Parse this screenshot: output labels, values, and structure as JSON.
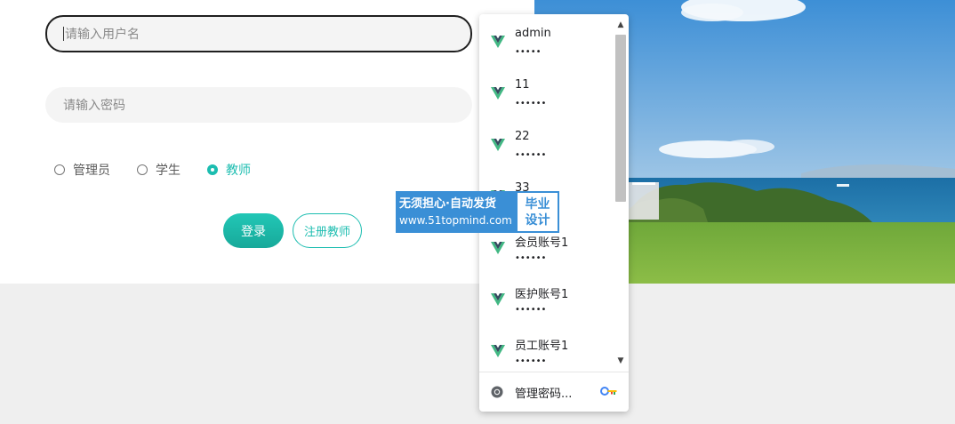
{
  "login": {
    "username_placeholder": "请输入用户名",
    "password_placeholder": "请输入密码",
    "roles": [
      {
        "label": "管理员",
        "selected": false
      },
      {
        "label": "学生",
        "selected": false
      },
      {
        "label": "教师",
        "selected": true
      }
    ],
    "login_label": "登录",
    "register_label": "注册教师",
    "accent_color": "#1cbdb0"
  },
  "watermark": {
    "line1": "无须担心·自动发货",
    "line2": "www.51topmind.com",
    "badge_line1": "毕业",
    "badge_line2": "设计"
  },
  "autofill": {
    "items": [
      {
        "username": "admin",
        "password": "•••••",
        "icon": "vue-logo-icon"
      },
      {
        "username": "11",
        "password": "••••••",
        "icon": "vue-logo-icon"
      },
      {
        "username": "22",
        "password": "••••••",
        "icon": "vue-logo-icon"
      },
      {
        "username": "33",
        "password": "••••••",
        "icon": "vue-logo-icon"
      },
      {
        "username": "会员账号1",
        "password": "••••••",
        "icon": "vue-logo-icon"
      },
      {
        "username": "医护账号1",
        "password": "••••••",
        "icon": "vue-logo-icon"
      },
      {
        "username": "员工账号1",
        "password": "••••••",
        "icon": "vue-logo-icon"
      }
    ],
    "manage_label": "管理密码..."
  }
}
